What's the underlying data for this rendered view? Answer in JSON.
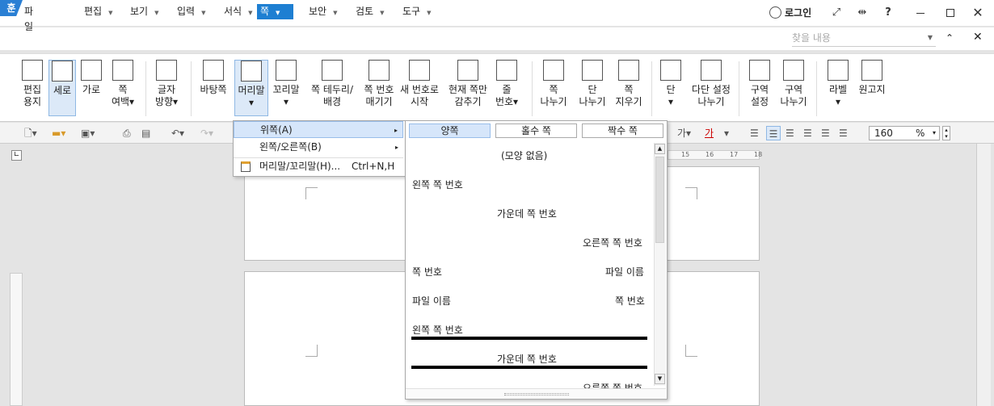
{
  "titlebar": {
    "app_icon": "훈",
    "login": "로그인",
    "icons": [
      "fit-icon",
      "split-icon",
      "help-icon",
      "minimize-icon",
      "maximize-icon",
      "close-icon"
    ],
    "help": "?"
  },
  "menus": [
    {
      "label": "파일",
      "arrow": false
    },
    {
      "label": "편집",
      "arrow": true
    },
    {
      "label": "보기",
      "arrow": true
    },
    {
      "label": "입력",
      "arrow": true
    },
    {
      "label": "서식",
      "arrow": true
    },
    {
      "label": "쪽",
      "arrow": true,
      "active": true
    },
    {
      "label": "보안",
      "arrow": true
    },
    {
      "label": "검토",
      "arrow": true
    },
    {
      "label": "도구",
      "arrow": true
    }
  ],
  "search": {
    "placeholder": "찾을 내용"
  },
  "ribbon": [
    {
      "l1": "편집",
      "l2": "용지"
    },
    {
      "l1": "세로",
      "l2": "",
      "selected": true
    },
    {
      "l1": "가로",
      "l2": ""
    },
    {
      "l1": "쪽",
      "l2": "여백▾"
    },
    {
      "l1": "글자",
      "l2": "방향▾"
    },
    {
      "l1": "바탕쪽",
      "l2": ""
    },
    {
      "l1": "머리말",
      "l2": "▾",
      "selected": true
    },
    {
      "l1": "꼬리말",
      "l2": "▾"
    },
    {
      "l1": "쪽 테두리/",
      "l2": "배경"
    },
    {
      "l1": "쪽 번호",
      "l2": "매기기"
    },
    {
      "l1": "새 번호로",
      "l2": "시작"
    },
    {
      "l1": "현재 쪽만",
      "l2": "감추기"
    },
    {
      "l1": "줄",
      "l2": "번호▾"
    },
    {
      "l1": "쪽",
      "l2": "나누기"
    },
    {
      "l1": "단",
      "l2": "나누기"
    },
    {
      "l1": "쪽",
      "l2": "지우기"
    },
    {
      "l1": "단",
      "l2": "▾"
    },
    {
      "l1": "다단 설정",
      "l2": "나누기"
    },
    {
      "l1": "구역",
      "l2": "설정"
    },
    {
      "l1": "구역",
      "l2": "나누기"
    },
    {
      "l1": "라벨",
      "l2": "▾"
    },
    {
      "l1": "원고지",
      "l2": ""
    }
  ],
  "toolbar2": {
    "zoom": "160",
    "zoom_unit": "%",
    "font_glyph": "가"
  },
  "submenu": [
    {
      "label": "위쪽(A)",
      "arrow": "▸"
    },
    {
      "label": "왼쪽/오른쪽(B)",
      "arrow": "▸"
    },
    {
      "label": "머리말/꼬리말(H)...",
      "shortcut": "Ctrl+N,H"
    }
  ],
  "gallery": {
    "tabs": [
      "양쪽",
      "홀수 쪽",
      "짝수 쪽"
    ],
    "none": "(모양 없음)",
    "left_page_no": "왼쪽 쪽 번호",
    "center_page_no": "가운데 쪽 번호",
    "right_page_no": "오른쪽 쪽 번호",
    "row4_left": "쪽 번호",
    "row4_right": "파일 이름",
    "row5_left": "파일 이름",
    "row5_right": "쪽 번호",
    "row6": "왼쪽 쪽 번호",
    "row7": "가운데 쪽 번호",
    "row8": "오른쪽 쪽 번호"
  },
  "ruler_nums": [
    "15",
    "16",
    "17",
    "18"
  ]
}
